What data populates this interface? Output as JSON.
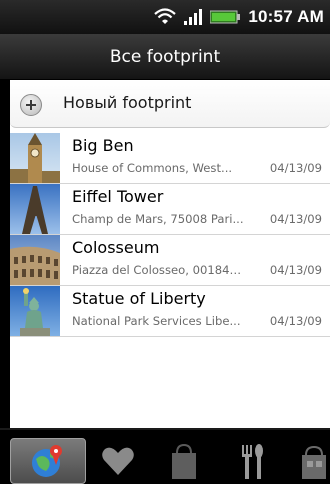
{
  "status_bar": {
    "time": "10:57 AM"
  },
  "header": {
    "title": "Все footprint"
  },
  "new_footprint": {
    "label": "Новый footprint"
  },
  "footprints": [
    {
      "name": "Big Ben",
      "address": "House of Commons, West...",
      "date": "04/13/09",
      "icon": "big-ben-thumbnail"
    },
    {
      "name": "Eiffel Tower",
      "address": "Champ de Mars, 75008 Pari...",
      "date": "04/13/09",
      "icon": "eiffel-tower-thumbnail"
    },
    {
      "name": "Colosseum",
      "address": "Piazza del Colosseo, 00184 ...",
      "date": "04/13/09",
      "icon": "colosseum-thumbnail"
    },
    {
      "name": "Statue of Liberty",
      "address": "National Park Services Libe...",
      "date": "04/13/09",
      "icon": "statue-of-liberty-thumbnail"
    }
  ],
  "tabs": [
    {
      "name": "globe-pin-icon",
      "selected": true
    },
    {
      "name": "heart-icon",
      "selected": false
    },
    {
      "name": "shopping-bag-icon",
      "selected": false
    },
    {
      "name": "fork-knife-icon",
      "selected": false
    },
    {
      "name": "attraction-icon",
      "selected": false
    }
  ],
  "colors": {
    "title_bar": "#2a2a2a",
    "list_bg": "#ffffff",
    "selected_tab": "#6a6a6a"
  }
}
